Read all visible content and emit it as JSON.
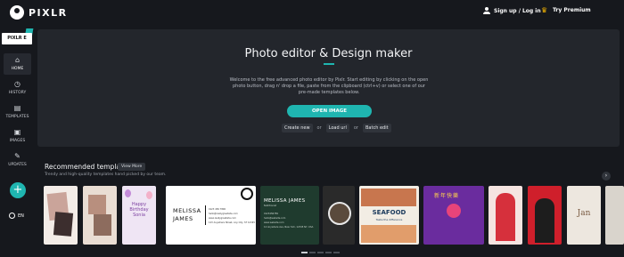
{
  "header": {
    "logo_text": "PIXLR",
    "signup_label": "Sign up / Log in",
    "premium_label": "Try Premium"
  },
  "sidebar": {
    "tag": "PIXLR E",
    "items": [
      {
        "label": "HOME",
        "icon": "home-icon"
      },
      {
        "label": "HISTORY",
        "icon": "history-icon"
      },
      {
        "label": "TEMPLATES",
        "icon": "templates-icon"
      },
      {
        "label": "IMAGES",
        "icon": "images-icon"
      },
      {
        "label": "UPDATES",
        "icon": "updates-icon"
      }
    ],
    "add_label": "+",
    "lang": "EN"
  },
  "hero": {
    "title": "Photo editor & Design maker",
    "description": "Welcome to the free advanced photo editor by Pixlr. Start editing by clicking on the open photo button, drag n' drop a file, paste from the clipboard (ctrl+v) or select one of our pre-made templates below.",
    "open_button": "OPEN IMAGE",
    "create_new": "Create new",
    "or1": "or",
    "load_url": "Load url",
    "or2": "or",
    "batch_edit": "Batch edit"
  },
  "recommended": {
    "title": "Recommended templates",
    "view_more": "View More",
    "subtitle": "Trendy and high-quality templates hand picked by our team.",
    "next_arrow": "›",
    "templates": {
      "birthday_text": "Happy Birthday Sonia",
      "card1_name": "MELISSA JAMES",
      "card2_name": "MELISSA JAMES",
      "card2_role": "Nutritionist",
      "card2_lines": [
        "0123456789",
        "hello@website.com",
        "www.website.com",
        "12 Anywhere Ave, New York, 12345 NY, USA"
      ],
      "card1_lines": [
        "0123 456 7890",
        "hello@reallygreatsite.com",
        "www.reallygreatsite.com",
        "123 Anywhere Street, Any City, ST 12345"
      ],
      "seafood_text": "SEAFOOD",
      "seafood_sub": "Taste the difference",
      "chinese_text": "新年快樂",
      "jan_text": "Jan"
    }
  },
  "colors": {
    "accent": "#1fb5b0",
    "background": "#16181d",
    "panel": "#23262c",
    "premium_icon": "#f5b400"
  }
}
